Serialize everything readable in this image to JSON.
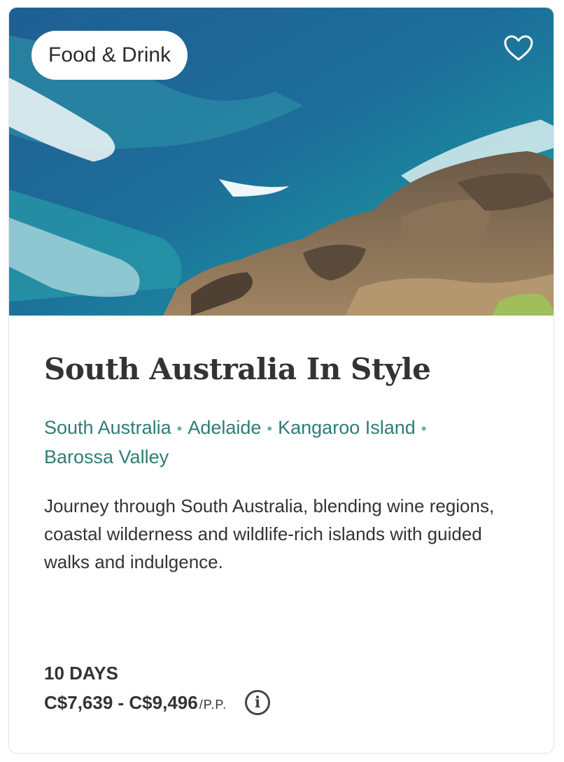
{
  "card": {
    "category_tag": "Food & Drink",
    "favorite_icon": "heart-icon",
    "title": "South Australia In Style",
    "locations": [
      "South Australia",
      "Adelaide",
      "Kangaroo Island",
      "Barossa Valley"
    ],
    "location_separator": "•",
    "description": "Journey through South Australia, blending wine regions, coastal wilderness and wildlife-rich islands with guided walks and indulgence.",
    "duration": "10 DAYS",
    "price": "C$7,639 - C$9,496",
    "price_unit": "/P.P.",
    "info_icon": "info-icon",
    "info_glyph": "i"
  },
  "colors": {
    "location_text": "#2e7d75",
    "text": "#333333"
  }
}
